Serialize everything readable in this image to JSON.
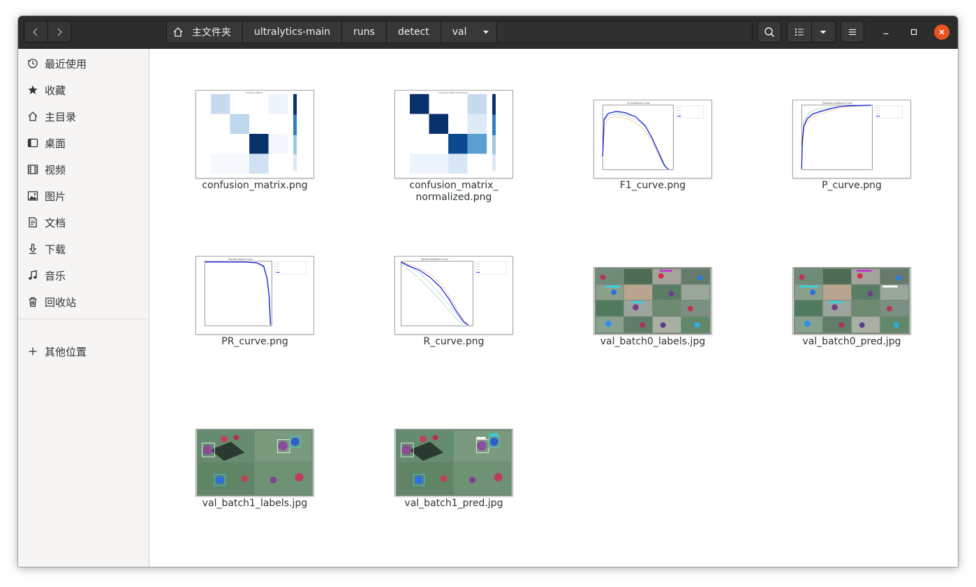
{
  "pathbar": {
    "home_label": "主文件夹",
    "crumbs": [
      "ultralytics-main",
      "runs",
      "detect"
    ],
    "current": "val"
  },
  "sidebar": {
    "items": [
      {
        "label": "最近使用",
        "icon": "clock-icon"
      },
      {
        "label": "收藏",
        "icon": "star-icon"
      },
      {
        "label": "主目录",
        "icon": "home-icon"
      },
      {
        "label": "桌面",
        "icon": "desktop-icon"
      },
      {
        "label": "视频",
        "icon": "film-icon"
      },
      {
        "label": "图片",
        "icon": "image-icon"
      },
      {
        "label": "文档",
        "icon": "document-icon"
      },
      {
        "label": "下载",
        "icon": "download-icon"
      },
      {
        "label": "音乐",
        "icon": "music-icon"
      },
      {
        "label": "回收站",
        "icon": "trash-icon"
      }
    ],
    "other_locations": "其他位置"
  },
  "files": [
    {
      "name": "confusion_matrix.png",
      "line1": "confusion_matrix.png",
      "line2": ""
    },
    {
      "name": "confusion_matrix_normalized.png",
      "line1": "confusion_matrix_",
      "line2": "normalized.png"
    },
    {
      "name": "F1_curve.png",
      "line1": "F1_curve.png",
      "line2": ""
    },
    {
      "name": "P_curve.png",
      "line1": "P_curve.png",
      "line2": ""
    },
    {
      "name": "PR_curve.png",
      "line1": "PR_curve.png",
      "line2": ""
    },
    {
      "name": "R_curve.png",
      "line1": "R_curve.png",
      "line2": ""
    },
    {
      "name": "val_batch0_labels.jpg",
      "line1": "val_batch0_labels.jpg",
      "line2": ""
    },
    {
      "name": "val_batch0_pred.jpg",
      "line1": "val_batch0_pred.jpg",
      "line2": ""
    },
    {
      "name": "val_batch1_labels.jpg",
      "line1": "val_batch1_labels.jpg",
      "line2": ""
    },
    {
      "name": "val_batch1_pred.jpg",
      "line1": "val_batch1_pred.jpg",
      "line2": ""
    }
  ],
  "thumbnails": {
    "matrix_titles": [
      "Confusion Matrix",
      "Confusion Matrix Normalized"
    ],
    "curve_titles": [
      "F1-Confidence Curve",
      "Precision-Confidence Curve",
      "Precision-Recall Curve",
      "Recall-Confidence Curve"
    ],
    "colors": {
      "accent": "#e95420",
      "curve_main": "#1f1fe0",
      "matrix_dark": "#08306b"
    }
  }
}
